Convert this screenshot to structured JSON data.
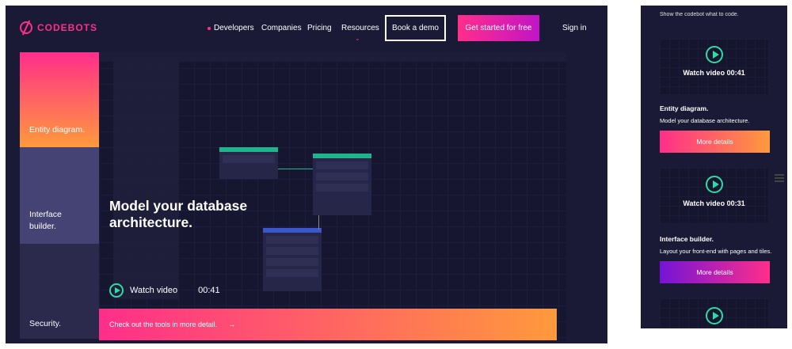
{
  "nav": {
    "brand": "CODEBOTS",
    "links": [
      "Developers",
      "Companies",
      "Pricing",
      "Resources"
    ],
    "demo_button": "Book a demo",
    "start_button": "Get started for free",
    "signin": "Sign in"
  },
  "sidebar": {
    "items": [
      {
        "label": "Entity diagram."
      },
      {
        "label": "Interface builder."
      },
      {
        "label": "Security."
      }
    ]
  },
  "hero": {
    "headline": "Model your database architecture.",
    "watch_label": "Watch video",
    "duration": "00:41",
    "cta": "Check out the tools in more detail.",
    "cta_arrow": "→"
  },
  "mobile": {
    "top_text": "Show the codebot what to code.",
    "cards": [
      {
        "watch": "Watch video 00:41",
        "title": "Entity diagram.",
        "desc": "Model your database architecture.",
        "button": "More details"
      },
      {
        "watch": "Watch video 00:31",
        "title": "Interface builder.",
        "desc": "Layout your front-end with pages and tiles.",
        "button": "More details"
      }
    ]
  },
  "colors": {
    "accent": "#ff2e8a",
    "orange": "#ff9a3c",
    "teal": "#2fdba4",
    "bg": "#1a1a36"
  },
  "icons": [
    "logo-icon",
    "play-icon",
    "arrow-right-icon",
    "hamburger-icon"
  ]
}
